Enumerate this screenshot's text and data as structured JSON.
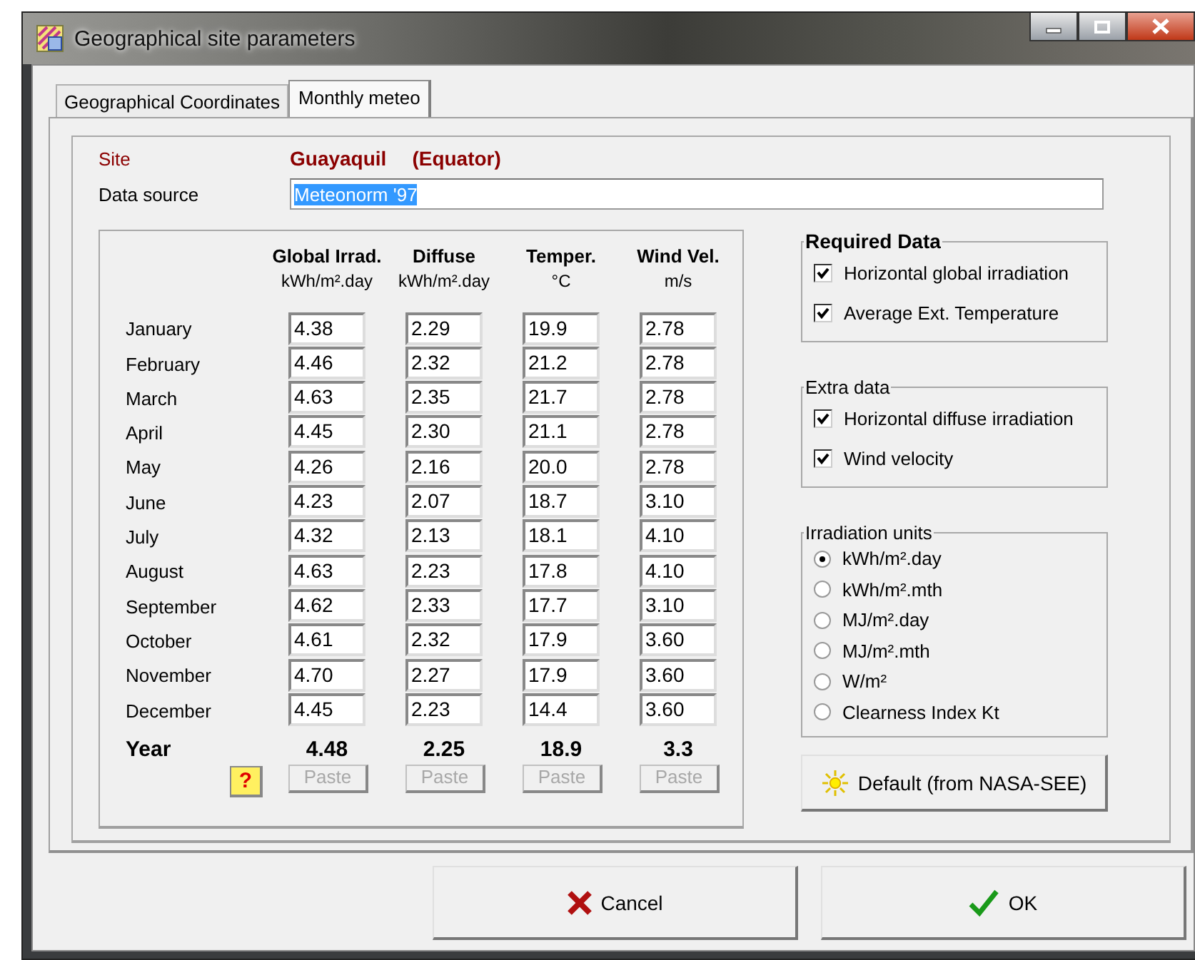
{
  "window": {
    "title": "Geographical site parameters"
  },
  "tabs": [
    {
      "label": "Geographical Coordinates",
      "selected": false
    },
    {
      "label": "Monthly meteo",
      "selected": true
    }
  ],
  "site": {
    "label": "Site",
    "name": "Guayaquil",
    "country": "(Equator)"
  },
  "data_source": {
    "label": "Data source",
    "value": "Meteonorm '97",
    "highlighted": true
  },
  "table": {
    "year_label": "Year",
    "help_button": "?",
    "columns": [
      {
        "name": "Global Irrad.",
        "unit": "kWh/m².day",
        "year": "4.48",
        "paste": "Paste",
        "paste_disabled": true
      },
      {
        "name": "Diffuse",
        "unit": "kWh/m².day",
        "year": "2.25",
        "paste": "Paste",
        "paste_disabled": true
      },
      {
        "name": "Temper.",
        "unit": "°C",
        "year": "18.9",
        "paste": "Paste",
        "paste_disabled": true
      },
      {
        "name": "Wind Vel.",
        "unit": "m/s",
        "year": "3.3",
        "paste": "Paste",
        "paste_disabled": true
      }
    ],
    "rows": [
      {
        "month": "January",
        "values": [
          "4.38",
          "2.29",
          "19.9",
          "2.78"
        ]
      },
      {
        "month": "February",
        "values": [
          "4.46",
          "2.32",
          "21.2",
          "2.78"
        ]
      },
      {
        "month": "March",
        "values": [
          "4.63",
          "2.35",
          "21.7",
          "2.78"
        ]
      },
      {
        "month": "April",
        "values": [
          "4.45",
          "2.30",
          "21.1",
          "2.78"
        ]
      },
      {
        "month": "May",
        "values": [
          "4.26",
          "2.16",
          "20.0",
          "2.78"
        ]
      },
      {
        "month": "June",
        "values": [
          "4.23",
          "2.07",
          "18.7",
          "3.10"
        ]
      },
      {
        "month": "July",
        "values": [
          "4.32",
          "2.13",
          "18.1",
          "4.10"
        ]
      },
      {
        "month": "August",
        "values": [
          "4.63",
          "2.23",
          "17.8",
          "4.10"
        ]
      },
      {
        "month": "September",
        "values": [
          "4.62",
          "2.33",
          "17.7",
          "3.10"
        ]
      },
      {
        "month": "October",
        "values": [
          "4.61",
          "2.32",
          "17.9",
          "3.60"
        ]
      },
      {
        "month": "November",
        "values": [
          "4.70",
          "2.27",
          "17.9",
          "3.60"
        ]
      },
      {
        "month": "December",
        "values": [
          "4.45",
          "2.23",
          "14.4",
          "3.60"
        ]
      }
    ]
  },
  "required_data": {
    "title": "Required Data",
    "items": [
      {
        "label": "Horizontal global irradiation",
        "checked": true
      },
      {
        "label": "Average Ext. Temperature",
        "checked": true
      }
    ]
  },
  "extra_data": {
    "title": "Extra data",
    "items": [
      {
        "label": "Horizontal diffuse irradiation",
        "checked": true
      },
      {
        "label": "Wind velocity",
        "checked": true
      }
    ]
  },
  "irradiation_units": {
    "title": "Irradiation units",
    "options": [
      {
        "label": "kWh/m².day",
        "selected": true
      },
      {
        "label": "kWh/m².mth",
        "selected": false
      },
      {
        "label": "MJ/m².day",
        "selected": false
      },
      {
        "label": "MJ/m².mth",
        "selected": false
      },
      {
        "label": "W/m²",
        "selected": false
      },
      {
        "label": "Clearness Index Kt",
        "selected": false
      }
    ]
  },
  "default_button": "Default (from NASA-SEE)",
  "buttons": [
    {
      "label": "Cancel",
      "kind": "cancel"
    },
    {
      "label": "OK",
      "kind": "ok"
    }
  ]
}
